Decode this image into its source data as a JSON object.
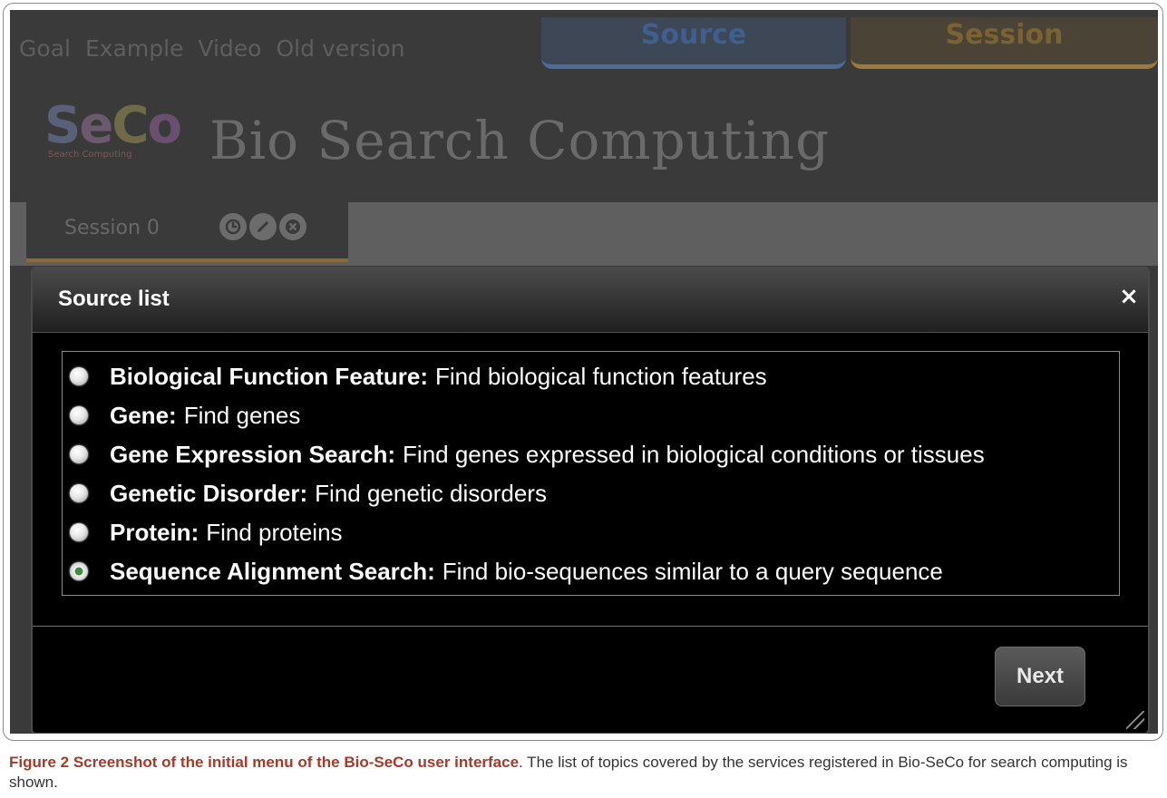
{
  "nav": {
    "items": [
      "Goal",
      "Example",
      "Video",
      "Old version"
    ]
  },
  "top_tabs": {
    "source": "Source",
    "session": "Session"
  },
  "logo": {
    "letters": [
      "S",
      "e",
      "C",
      "o"
    ],
    "subtitle": "Search Computing"
  },
  "app_title": "Bio Search Computing",
  "session_tab": {
    "label": "Session 0",
    "icons": [
      "clock-icon",
      "pencil-icon",
      "close-icon"
    ]
  },
  "modal": {
    "title": "Source list",
    "close": "×",
    "items": [
      {
        "name": "Biological Function Feature:",
        "desc": "Find biological function features",
        "selected": false
      },
      {
        "name": "Gene:",
        "desc": "Find genes",
        "selected": false
      },
      {
        "name": "Gene Expression Search:",
        "desc": "Find genes expressed in biological conditions or tissues",
        "selected": false
      },
      {
        "name": "Genetic Disorder:",
        "desc": "Find genetic disorders",
        "selected": false
      },
      {
        "name": "Protein:",
        "desc": "Find proteins",
        "selected": false
      },
      {
        "name": "Sequence Alignment Search:",
        "desc": "Find bio-sequences similar to a query sequence",
        "selected": true
      }
    ],
    "next_label": "Next"
  },
  "caption": {
    "label": "Figure 2 Screenshot of the initial menu of the Bio-SeCo user interface",
    "text": ". The list of topics covered by the services registered in Bio-SeCo for search computing is shown."
  },
  "colors": {
    "background": "#3a3a3a",
    "modal": "#000000",
    "source_tab": "#4d6d98",
    "session_tab": "#9c7a3c",
    "selected_radio": "#3c8c3c"
  }
}
